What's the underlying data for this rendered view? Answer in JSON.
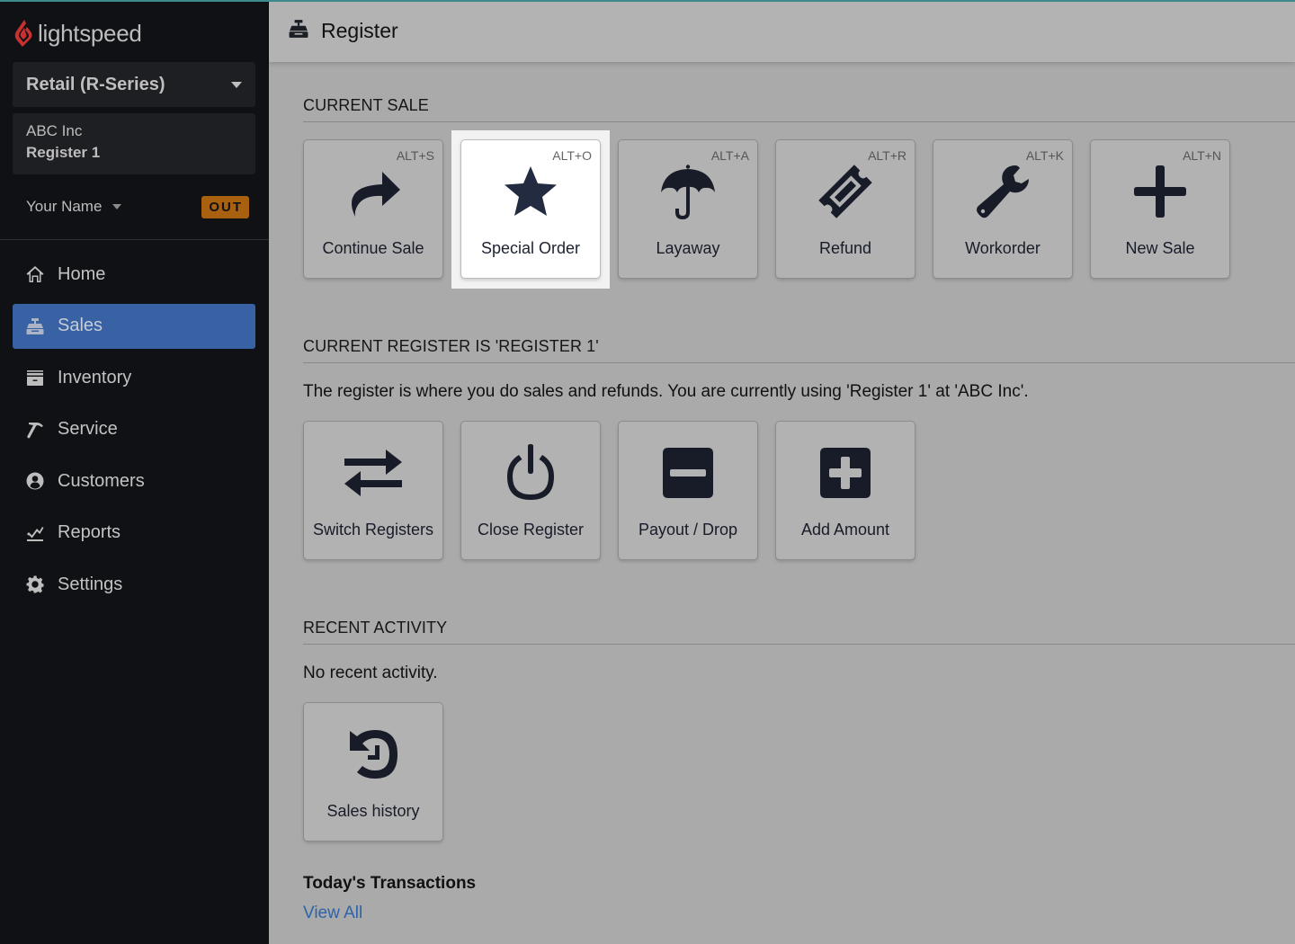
{
  "brand": {
    "name": "lightspeed",
    "logo_color": "#c8312f"
  },
  "sidebar": {
    "product_select": {
      "label": "Retail (R-Series)"
    },
    "shop": {
      "name": "ABC Inc",
      "register": "Register 1"
    },
    "user": {
      "name": "Your Name",
      "status_badge": "OUT",
      "status_color": "#a9610f"
    },
    "nav": [
      {
        "label": "Home",
        "icon": "home-icon",
        "active": false
      },
      {
        "label": "Sales",
        "icon": "cash-register-icon",
        "active": true
      },
      {
        "label": "Inventory",
        "icon": "archive-icon",
        "active": false
      },
      {
        "label": "Service",
        "icon": "hammer-icon",
        "active": false
      },
      {
        "label": "Customers",
        "icon": "user-circle-icon",
        "active": false
      },
      {
        "label": "Reports",
        "icon": "chart-line-icon",
        "active": false
      },
      {
        "label": "Settings",
        "icon": "gear-icon",
        "active": false
      }
    ],
    "active_color": "#3862a3"
  },
  "header": {
    "title": "Register",
    "icon": "cash-register-icon"
  },
  "current_sale": {
    "title": "CURRENT SALE",
    "tiles": [
      {
        "label": "Continue Sale",
        "shortcut": "ALT+S",
        "icon": "share-arrow-icon",
        "highlighted": false
      },
      {
        "label": "Special Order",
        "shortcut": "ALT+O",
        "icon": "star-icon",
        "highlighted": true
      },
      {
        "label": "Layaway",
        "shortcut": "ALT+A",
        "icon": "umbrella-icon",
        "highlighted": false
      },
      {
        "label": "Refund",
        "shortcut": "ALT+R",
        "icon": "ticket-icon",
        "highlighted": false
      },
      {
        "label": "Workorder",
        "shortcut": "ALT+K",
        "icon": "wrench-icon",
        "highlighted": false
      },
      {
        "label": "New Sale",
        "shortcut": "ALT+N",
        "icon": "plus-icon",
        "highlighted": false
      }
    ]
  },
  "current_register": {
    "title": "CURRENT REGISTER IS 'REGISTER 1'",
    "description": "The register is where you do sales and refunds. You are currently using 'Register 1'  at 'ABC Inc'.",
    "tiles": [
      {
        "label": "Switch Registers",
        "icon": "exchange-icon"
      },
      {
        "label": "Close Register",
        "icon": "power-icon"
      },
      {
        "label": "Payout / Drop",
        "icon": "minus-square-icon"
      },
      {
        "label": "Add Amount",
        "icon": "plus-square-icon"
      }
    ]
  },
  "recent_activity": {
    "title": "RECENT ACTIVITY",
    "empty_text": "No recent activity.",
    "tiles": [
      {
        "label": "Sales history",
        "icon": "history-icon"
      }
    ]
  },
  "todays_transactions": {
    "title": "Today's Transactions",
    "link": "View All",
    "link_color": "#2c63a8"
  }
}
